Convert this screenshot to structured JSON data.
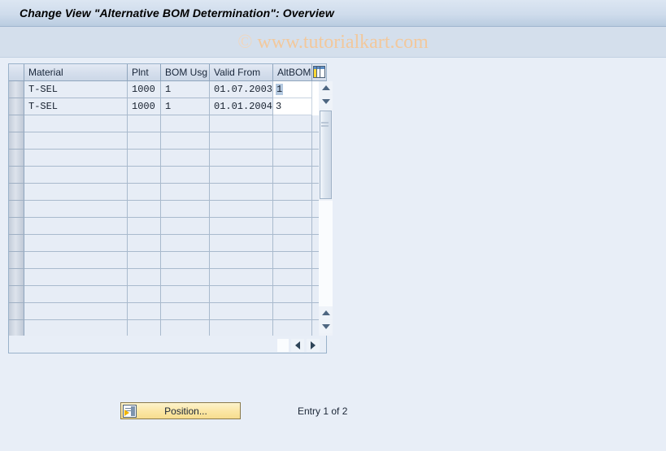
{
  "window": {
    "title": "Change View \"Alternative BOM Determination\": Overview"
  },
  "watermark": {
    "copyright_symbol": "©",
    "text": "www.tutorialkart.com"
  },
  "table": {
    "config_icon": "table-settings-icon",
    "columns": [
      {
        "key": "material",
        "label": "Material"
      },
      {
        "key": "plnt",
        "label": "Plnt"
      },
      {
        "key": "bom_usg",
        "label": "BOM Usg"
      },
      {
        "key": "valid_from",
        "label": "Valid From"
      },
      {
        "key": "alt_bom",
        "label": "AltBOM"
      }
    ],
    "rows": [
      {
        "material": "T-SEL",
        "plnt": "1000",
        "bom_usg": "1",
        "valid_from": "01.07.2003",
        "alt_bom": "1",
        "alt_bom_selected": true
      },
      {
        "material": "T-SEL",
        "plnt": "1000",
        "bom_usg": "1",
        "valid_from": "01.01.2004",
        "alt_bom": "3",
        "alt_bom_selected": false
      }
    ],
    "empty_row_count": 13,
    "scroll": {
      "up_icon": "scroll-up-icon",
      "down_icon": "scroll-down-icon",
      "page_up_icon": "page-up-icon",
      "page_down_icon": "page-down-icon",
      "left_icon": "scroll-left-icon",
      "right_icon": "scroll-right-icon"
    }
  },
  "footer": {
    "position_button": {
      "label": "Position...",
      "icon": "position-jump-icon"
    },
    "entry_status": "Entry 1 of 2"
  },
  "colors": {
    "title_bar": "#cfdcec",
    "page_background": "#e8eef7",
    "watermark": "#f2c89c",
    "grid_line": "#a9bacd",
    "button_yellow": "#fbe6a4",
    "selection_highlight": "#b4c9e0"
  }
}
